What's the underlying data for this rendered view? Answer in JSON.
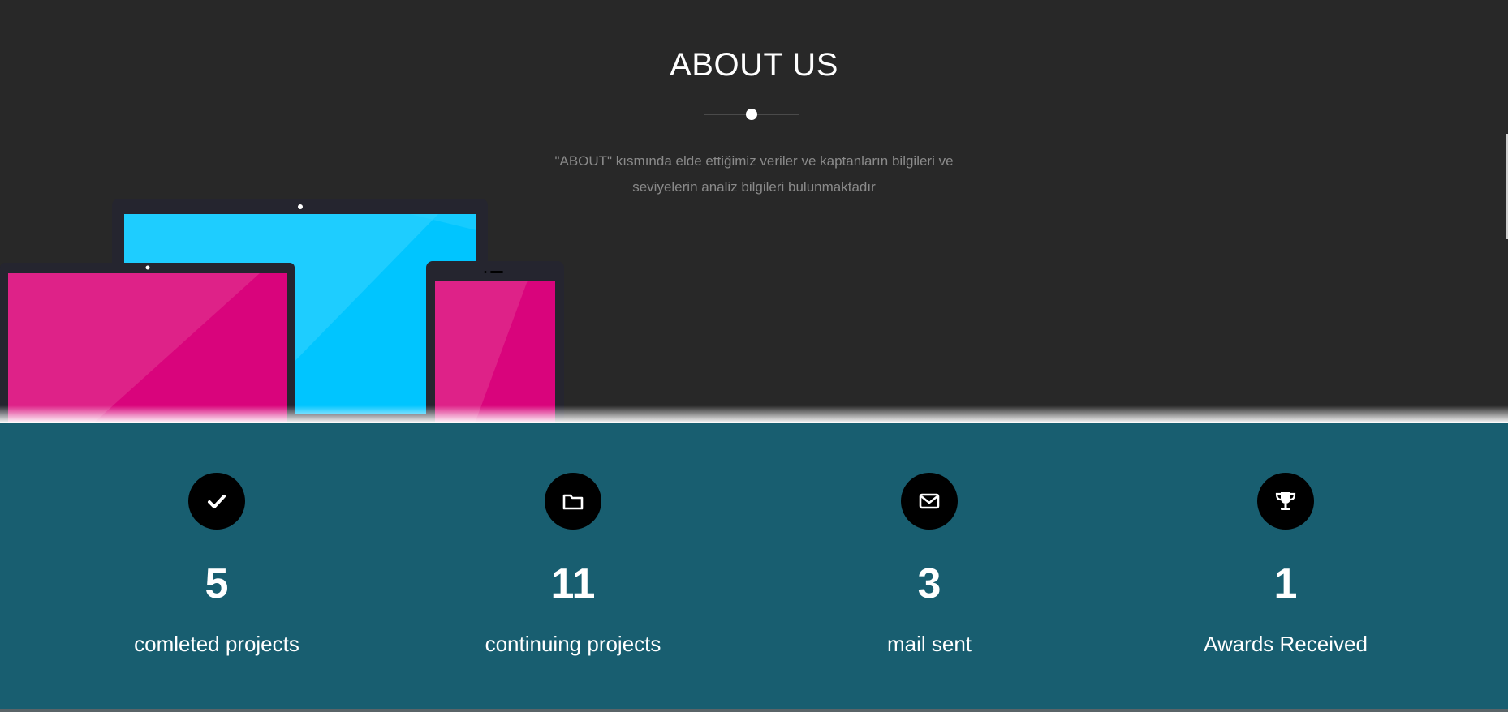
{
  "about": {
    "title": "ABOUT US",
    "description_line1": "\"ABOUT\" kısmında elde ettiğimiz veriler ve kaptanların bilgileri ve",
    "description_line2": "seviyelerin analiz bilgileri bulunmaktadır"
  },
  "colors": {
    "dark_bg": "#282828",
    "stats_bg": "#185e70",
    "cyan_screen": "#00c5ff",
    "pink_screen": "#d9047c",
    "device_frame": "#25252f"
  },
  "stats": [
    {
      "icon": "check-icon",
      "number": "5",
      "label": "comleted projects"
    },
    {
      "icon": "folder-icon",
      "number": "11",
      "label": "continuing projects"
    },
    {
      "icon": "envelope-icon",
      "number": "3",
      "label": "mail sent"
    },
    {
      "icon": "trophy-icon",
      "number": "1",
      "label": "Awards Received"
    }
  ]
}
